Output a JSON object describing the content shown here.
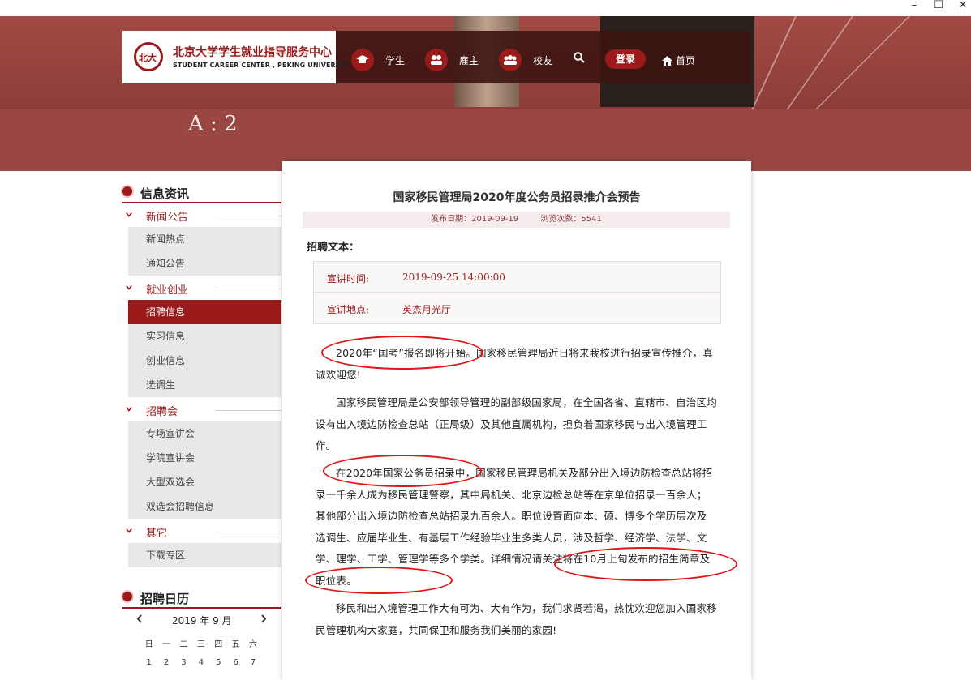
{
  "window": {
    "minimize": "–",
    "maximize": "☐",
    "close": "✕"
  },
  "header": {
    "logo_cn": "北京大学学生就业指导服务中心",
    "logo_en": "STUDENT CAREER CENTER , PEKING UNIVERSITY",
    "nav": [
      {
        "label": "学生",
        "icon": "graduation-cap-icon"
      },
      {
        "label": "雇主",
        "icon": "people-icon"
      },
      {
        "label": "校友",
        "icon": "group-icon"
      }
    ],
    "login": "登录",
    "home": "首页",
    "banner_text": "A        :  2"
  },
  "sidebar": {
    "info_title": "信息资讯",
    "categories": [
      {
        "label": "新闻公告",
        "items": [
          "新闻热点",
          "通知公告"
        ]
      },
      {
        "label": "就业创业",
        "items": [
          "招聘信息",
          "实习信息",
          "创业信息",
          "选调生"
        ]
      },
      {
        "label": "招聘会",
        "items": [
          "专场宣讲会",
          "学院宣讲会",
          "大型双选会",
          "双选会招聘信息"
        ]
      },
      {
        "label": "其它",
        "items": [
          "下载专区"
        ]
      }
    ],
    "active_item": "招聘信息",
    "calendar_title": "招聘日历",
    "calendar": {
      "month_label": "2019 年 9 月",
      "weekdays": [
        "日",
        "一",
        "二",
        "三",
        "四",
        "五",
        "六"
      ],
      "first_row": [
        "1",
        "2",
        "3",
        "4",
        "5",
        "6",
        "7"
      ]
    }
  },
  "article": {
    "title": "国家移民管理局2020年度公务员招录推介会预告",
    "publish_date": "发布日期：2019-09-19",
    "views": "浏览次数：5541",
    "section_label": "招聘文本：",
    "info": [
      {
        "key": "宣讲时间:",
        "value": "2019-09-25 14:00:00"
      },
      {
        "key": "宣讲地点:",
        "value": "英杰月光厅"
      }
    ],
    "paragraphs": [
      "2020年“国考”报名即将开始。国家移民管理局近日将来我校进行招录宣传推介，真诚欢迎您!",
      "国家移民管理局是公安部领导管理的副部级国家局，在全国各省、直辖市、自治区均设有出入境边防检查总站（正局级）及其他直属机构，担负着国家移民与出入境管理工作。",
      "在2020年国家公务员招录中，国家移民管理局机关及部分出入境边防检查总站将招录一千余人成为移民管理警察，其中局机关、北京边检总站等在京单位招录一百余人；其他部分出入境边防检查总站招录九百余人。职位设置面向本、硕、博多个学历层次及选调生、应届毕业生、有基层工作经验毕业生多类人员，涉及哲学、经济学、法学、文学、理学、工学、管理学等多个学类。详细情况请关注将在10月上旬发布的招生简章及职位表。",
      "移民和出入境管理工作大有可为、大有作为，我们求贤若渴，热忱欢迎您加入国家移民管理机构大家庭，共同保卫和服务我们美丽的家园!"
    ]
  },
  "colors": {
    "brand": "#9b1b1b",
    "banner": "#9a4643",
    "annotation": "#e01515"
  }
}
